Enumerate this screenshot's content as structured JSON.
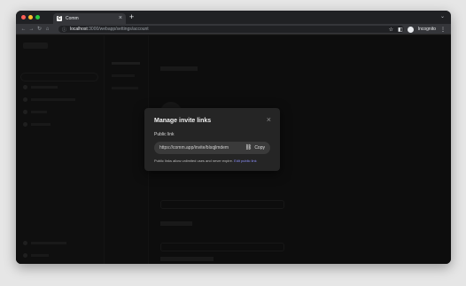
{
  "browser": {
    "tab_title": "Comm",
    "tab_favicon": "C",
    "new_tab_icon": "+",
    "close_tab_icon": "×",
    "url_host": "localhost",
    "url_path": ":3000/webapp/settings/account",
    "incognito_label": "Incognito",
    "colors": {
      "red": "#ff5f57",
      "yellow": "#febc2e",
      "green": "#28c840"
    }
  },
  "modal": {
    "title": "Manage invite links",
    "close_icon": "×",
    "public_link_label": "Public link",
    "link_url": "https://comm.app/invite/blsqjlmdem",
    "copy_label": "Copy",
    "note_text": "Public links allow unlimited uses and never expire.",
    "edit_link_label": "Edit public link",
    "accent_color": "#8b8ff8"
  }
}
